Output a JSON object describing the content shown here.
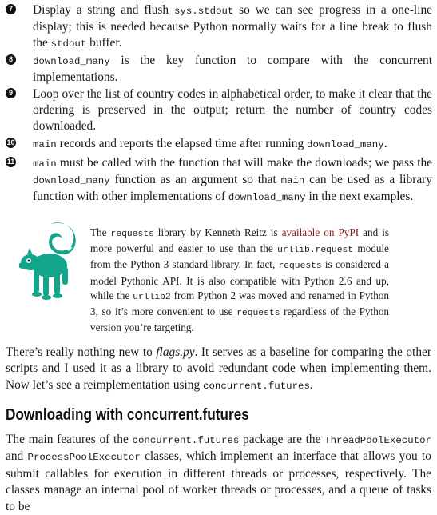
{
  "callouts": [
    {
      "number": "7",
      "parts": [
        "Display a string and flush ",
        "sys.stdout",
        " so we can see progress in a one-line display; this is needed because Python normally waits for a line break to flush the ",
        "stdout",
        " buffer."
      ]
    },
    {
      "number": "8",
      "parts": [
        "download_many",
        " is the key function to compare with the concurrent implementations."
      ]
    },
    {
      "number": "9",
      "parts": [
        "Loop over the list of country codes in alphabetical order, to make it clear that the ordering is preserved in the output; return the number of country codes downloaded."
      ]
    },
    {
      "number": "10",
      "parts": [
        "main",
        " records and reports the elapsed time after running ",
        "download_many",
        "."
      ]
    },
    {
      "number": "11",
      "parts": [
        "main",
        " must be called with the function that will make the downloads; we pass the ",
        "download_many",
        " function as an argument so that ",
        "main",
        " can be used as a library function with other implementations of ",
        "download_many",
        " in the next examples."
      ]
    }
  ],
  "note": {
    "icon": "lemur-icon",
    "t1": "The ",
    "c1": "requests",
    "t2": " library by Kenneth Reitz is ",
    "link": "available on PyPI",
    "t3": " and is more powerful and easier to use than the ",
    "c2": "urllib.request",
    "t4": " module from the Python 3 standard library. In fact, ",
    "c3": "requests",
    "t5": " is considered a model Pythonic API. It is also compatible with Python 2.6 and up, while the ",
    "c4": "urllib2",
    "t6": " from Python 2 was moved and renamed in Python 3, so it’s more convenient to use ",
    "c5": "requests",
    "t7": " regardless of the Python version you’re targeting."
  },
  "para1": {
    "t1": "There’s really nothing new to ",
    "em": "flags.py",
    "t2": ". It serves as a baseline for comparing the other scripts and I used it as a library to avoid redundant code when implementing them. Now let’s see a reimplementation using ",
    "c1": "concurrent.futures",
    "t3": "."
  },
  "heading": "Downloading with concurrent.futures",
  "para2": {
    "t1": "The main features of the ",
    "c1": "concurrent.futures",
    "t2": " package are the ",
    "c2": "ThreadPoolExecutor",
    "t3": " and ",
    "c3": "ProcessPoolExecutor",
    "t4": " classes, which implement an interface that allows you to submit callables for execution in different threads or processes, respectively. The classes manage an internal pool of worker threads or processes, and a queue of tasks to be"
  }
}
